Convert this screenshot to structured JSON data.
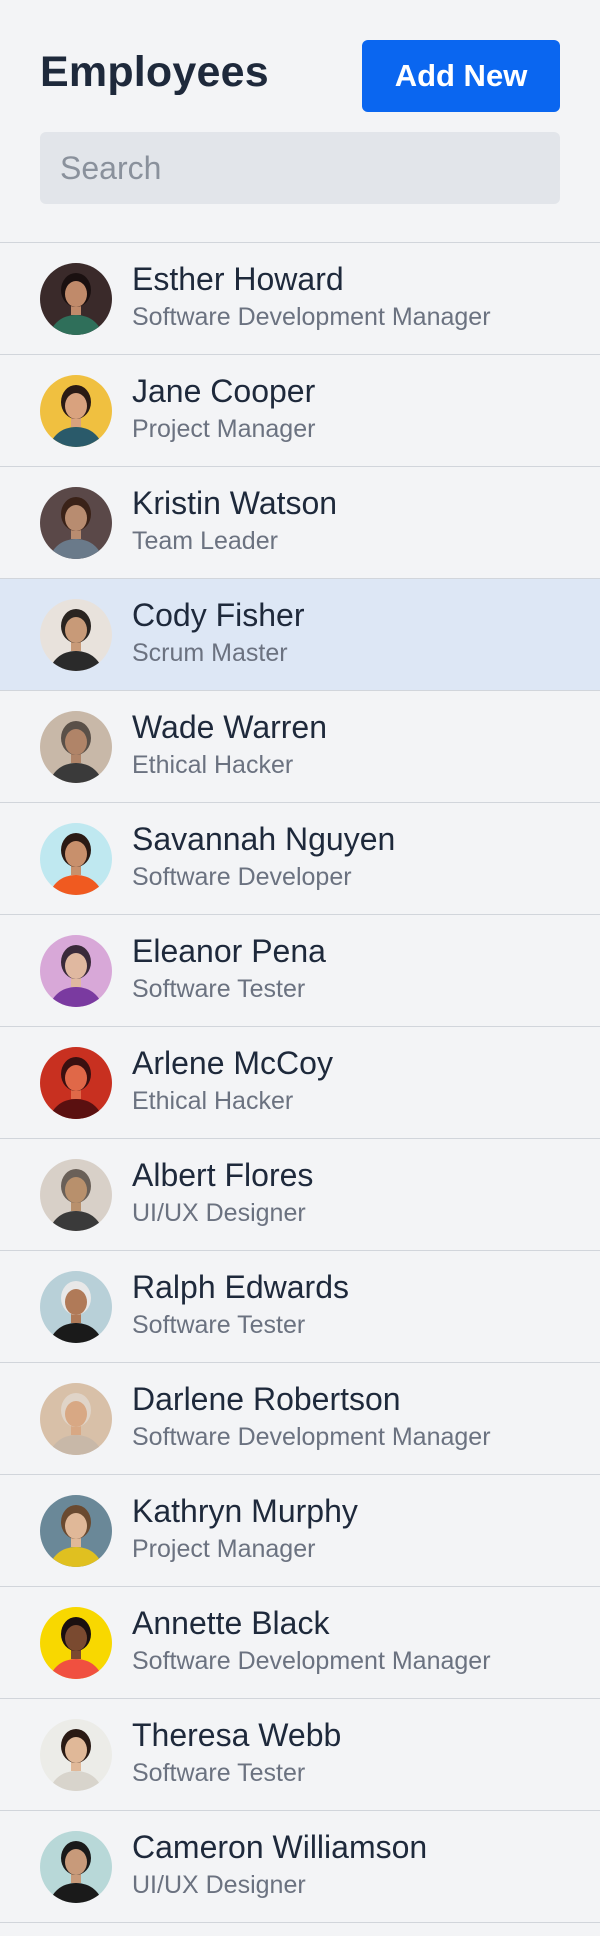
{
  "header": {
    "title": "Employees",
    "add_button_label": "Add New",
    "search_placeholder": "Search"
  },
  "employees": [
    {
      "name": "Esther Howard",
      "role": "Software Development Manager",
      "bg": "#3a2a2a",
      "skin": "#c08a6a",
      "hair": "#1a1010",
      "shirt": "#2f6f5a",
      "selected": false
    },
    {
      "name": "Jane Cooper",
      "role": "Project Manager",
      "bg": "#f0c040",
      "skin": "#d9a27e",
      "hair": "#2a1a14",
      "shirt": "#2a5a6a",
      "selected": false
    },
    {
      "name": "Kristin Watson",
      "role": "Team Leader",
      "bg": "#5a4848",
      "skin": "#b88c70",
      "hair": "#3a2218",
      "shirt": "#6a7a8a",
      "selected": false
    },
    {
      "name": "Cody Fisher",
      "role": "Scrum Master",
      "bg": "#e8e2dc",
      "skin": "#c89a78",
      "hair": "#2a2420",
      "shirt": "#2a2a2a",
      "selected": true
    },
    {
      "name": "Wade Warren",
      "role": "Ethical Hacker",
      "bg": "#c8b8a8",
      "skin": "#b08468",
      "hair": "#5a5048",
      "shirt": "#3a3a3a",
      "selected": false
    },
    {
      "name": "Savannah Nguyen",
      "role": "Software Developer",
      "bg": "#bfe8f0",
      "skin": "#c8906c",
      "hair": "#2a1a14",
      "shirt": "#f05a20",
      "selected": false
    },
    {
      "name": "Eleanor Pena",
      "role": "Software Tester",
      "bg": "#d8a8d8",
      "skin": "#e0b8a0",
      "hair": "#3a2a3a",
      "shirt": "#7a3aa0",
      "selected": false
    },
    {
      "name": "Arlene McCoy",
      "role": "Ethical Hacker",
      "bg": "#c83020",
      "skin": "#e06848",
      "hair": "#3a1010",
      "shirt": "#5a1010",
      "selected": false
    },
    {
      "name": "Albert Flores",
      "role": "UI/UX Designer",
      "bg": "#d8d0c8",
      "skin": "#b8906c",
      "hair": "#6a6058",
      "shirt": "#3a3a3a",
      "selected": false
    },
    {
      "name": "Ralph Edwards",
      "role": "Software Tester",
      "bg": "#b8d0d8",
      "skin": "#b07a58",
      "hair": "#e8e8e8",
      "shirt": "#1a1a1a",
      "selected": false
    },
    {
      "name": "Darlene Robertson",
      "role": "Software Development Manager",
      "bg": "#d8c0a8",
      "skin": "#d8a884",
      "hair": "#e0d4c8",
      "shirt": "#c8b8a8",
      "selected": false
    },
    {
      "name": "Kathryn Murphy",
      "role": "Project Manager",
      "bg": "#6a8898",
      "skin": "#e0b898",
      "hair": "#6a4a30",
      "shirt": "#e0c020",
      "selected": false
    },
    {
      "name": "Annette Black",
      "role": "Software Development Manager",
      "bg": "#f8d800",
      "skin": "#7a4a30",
      "hair": "#1a1010",
      "shirt": "#f05040",
      "selected": false
    },
    {
      "name": "Theresa Webb",
      "role": "Software Tester",
      "bg": "#ecece8",
      "skin": "#e0b898",
      "hair": "#2a1a14",
      "shirt": "#d8d4cc",
      "selected": false
    },
    {
      "name": "Cameron Williamson",
      "role": "UI/UX Designer",
      "bg": "#b8d8d8",
      "skin": "#c89a7a",
      "hair": "#1a1a1a",
      "shirt": "#1a1a1a",
      "selected": false
    }
  ]
}
